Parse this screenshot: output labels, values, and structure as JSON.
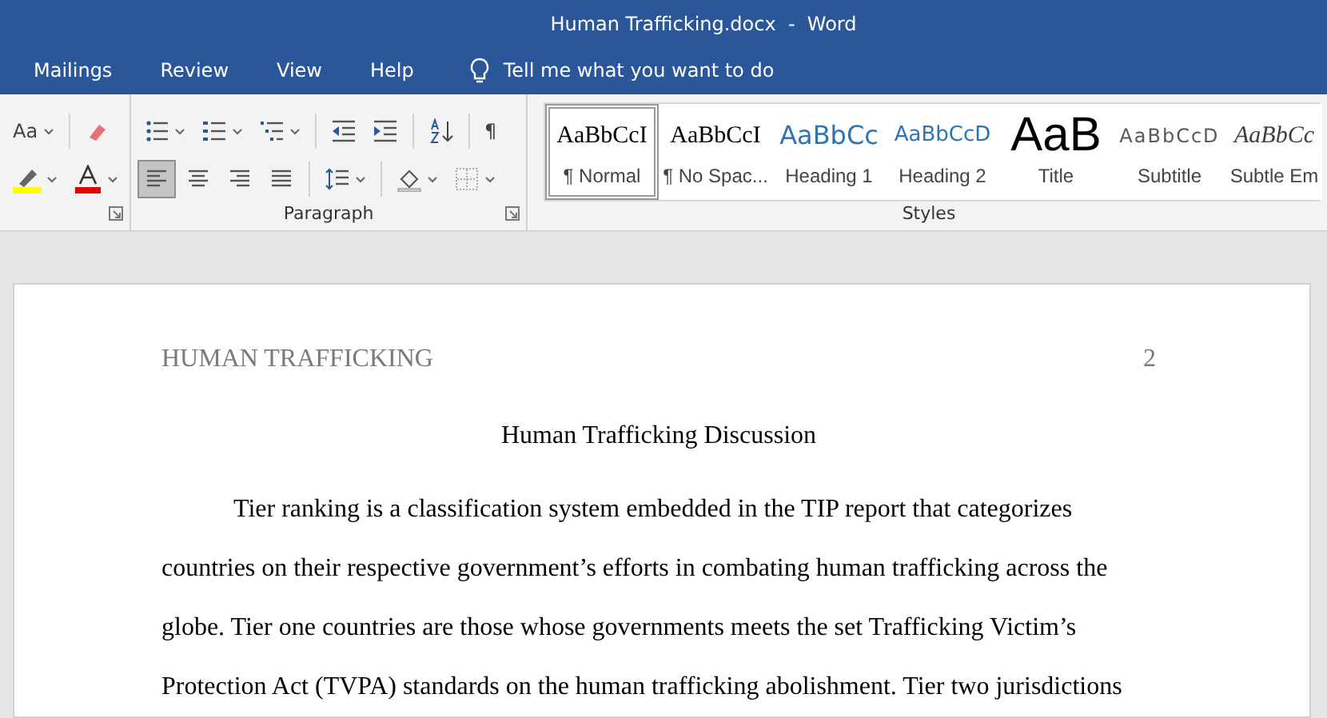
{
  "window": {
    "title": "Human Trafficking.docx  -  Word"
  },
  "tabs": [
    {
      "label": "Mailings",
      "selected": false
    },
    {
      "label": "Review",
      "selected": false
    },
    {
      "label": "View",
      "selected": false
    },
    {
      "label": "Help",
      "selected": false
    }
  ],
  "tell_me": {
    "placeholder": "Tell me what you want to do"
  },
  "font_group": {
    "change_case": "Aa"
  },
  "paragraph_group": {
    "label": "Paragraph",
    "pilcrow": "¶",
    "alignments": [
      {
        "kind": "left",
        "selected": true
      },
      {
        "kind": "center",
        "selected": false
      },
      {
        "kind": "right",
        "selected": false
      },
      {
        "kind": "justify",
        "selected": false
      }
    ]
  },
  "styles_group": {
    "label": "Styles",
    "styles": [
      {
        "kind": "body",
        "sample": "AaBbCcI",
        "name": "¶ Normal",
        "selected": true
      },
      {
        "kind": "body",
        "sample": "AaBbCcI",
        "name": "¶ No Spac...",
        "selected": false
      },
      {
        "kind": "heading1",
        "sample": "AaBbCc",
        "name": "Heading 1",
        "selected": false
      },
      {
        "kind": "heading2",
        "sample": "AaBbCcD",
        "name": "Heading 2",
        "selected": false
      },
      {
        "kind": "title",
        "sample": "AaB",
        "name": "Title",
        "selected": false
      },
      {
        "kind": "subtitle",
        "sample": "AaBbCcD",
        "name": "Subtitle",
        "selected": false
      },
      {
        "kind": "emphasis",
        "sample": "AaBbCc",
        "name": "Subtle Em",
        "selected": false
      }
    ]
  },
  "document": {
    "running_head": "HUMAN TRAFFICKING",
    "page_number": "2",
    "title": "Human Trafficking Discussion",
    "paragraph": "Tier ranking is a classification system embedded in the TIP report that categorizes countries on their respective government’s efforts in combating human trafficking across the globe. Tier one countries are those whose governments meets the set Trafficking Victim’s Protection Act (TVPA) standards on the human trafficking abolishment. Tier two jurisdictions"
  }
}
